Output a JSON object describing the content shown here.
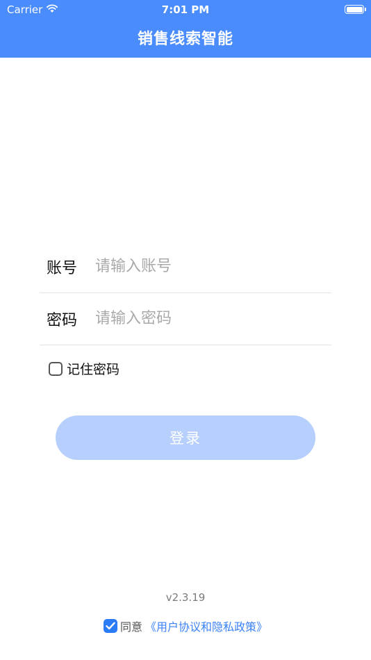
{
  "status_bar": {
    "carrier": "Carrier",
    "time": "7:01 PM"
  },
  "header": {
    "title": "销售线索智能",
    "color": "#4a8cfb"
  },
  "form": {
    "account": {
      "label": "账号",
      "placeholder": "请输入账号"
    },
    "password": {
      "label": "密码",
      "placeholder": "请输入密码"
    },
    "remember": {
      "label": "记住密码",
      "checked": false
    },
    "login_button": {
      "label": "登录",
      "color": "#b6cffc"
    }
  },
  "footer": {
    "version": "v2.3.19",
    "agreement": {
      "checked": true,
      "prefix": "同意",
      "link": "《用户协议和隐私政策》",
      "link_color": "#3b82f6"
    }
  }
}
